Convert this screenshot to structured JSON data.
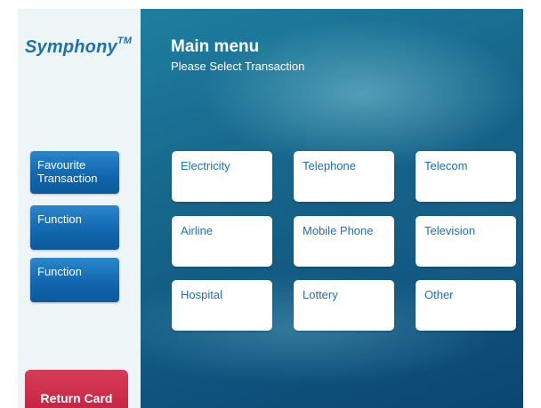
{
  "sidebar": {
    "logo_text": "Symphony",
    "logo_mark": "TM",
    "buttons": [
      {
        "label": "Favourite Transaction"
      },
      {
        "label": "Function"
      },
      {
        "label": "Function"
      }
    ],
    "return_card_label": "Return Card"
  },
  "header": {
    "title": "Main menu",
    "subtitle": "Please Select Transaction"
  },
  "transactions": [
    {
      "label": "Electricity"
    },
    {
      "label": "Telephone"
    },
    {
      "label": "Telecom"
    },
    {
      "label": "Airline"
    },
    {
      "label": "Mobile Phone"
    },
    {
      "label": "Television"
    },
    {
      "label": "Hospital"
    },
    {
      "label": "Lottery"
    },
    {
      "label": "Other"
    }
  ],
  "colors": {
    "accent_blue": "#1f6fb5",
    "return_red": "#c01e3c",
    "tile_text": "#1a6fbe"
  }
}
